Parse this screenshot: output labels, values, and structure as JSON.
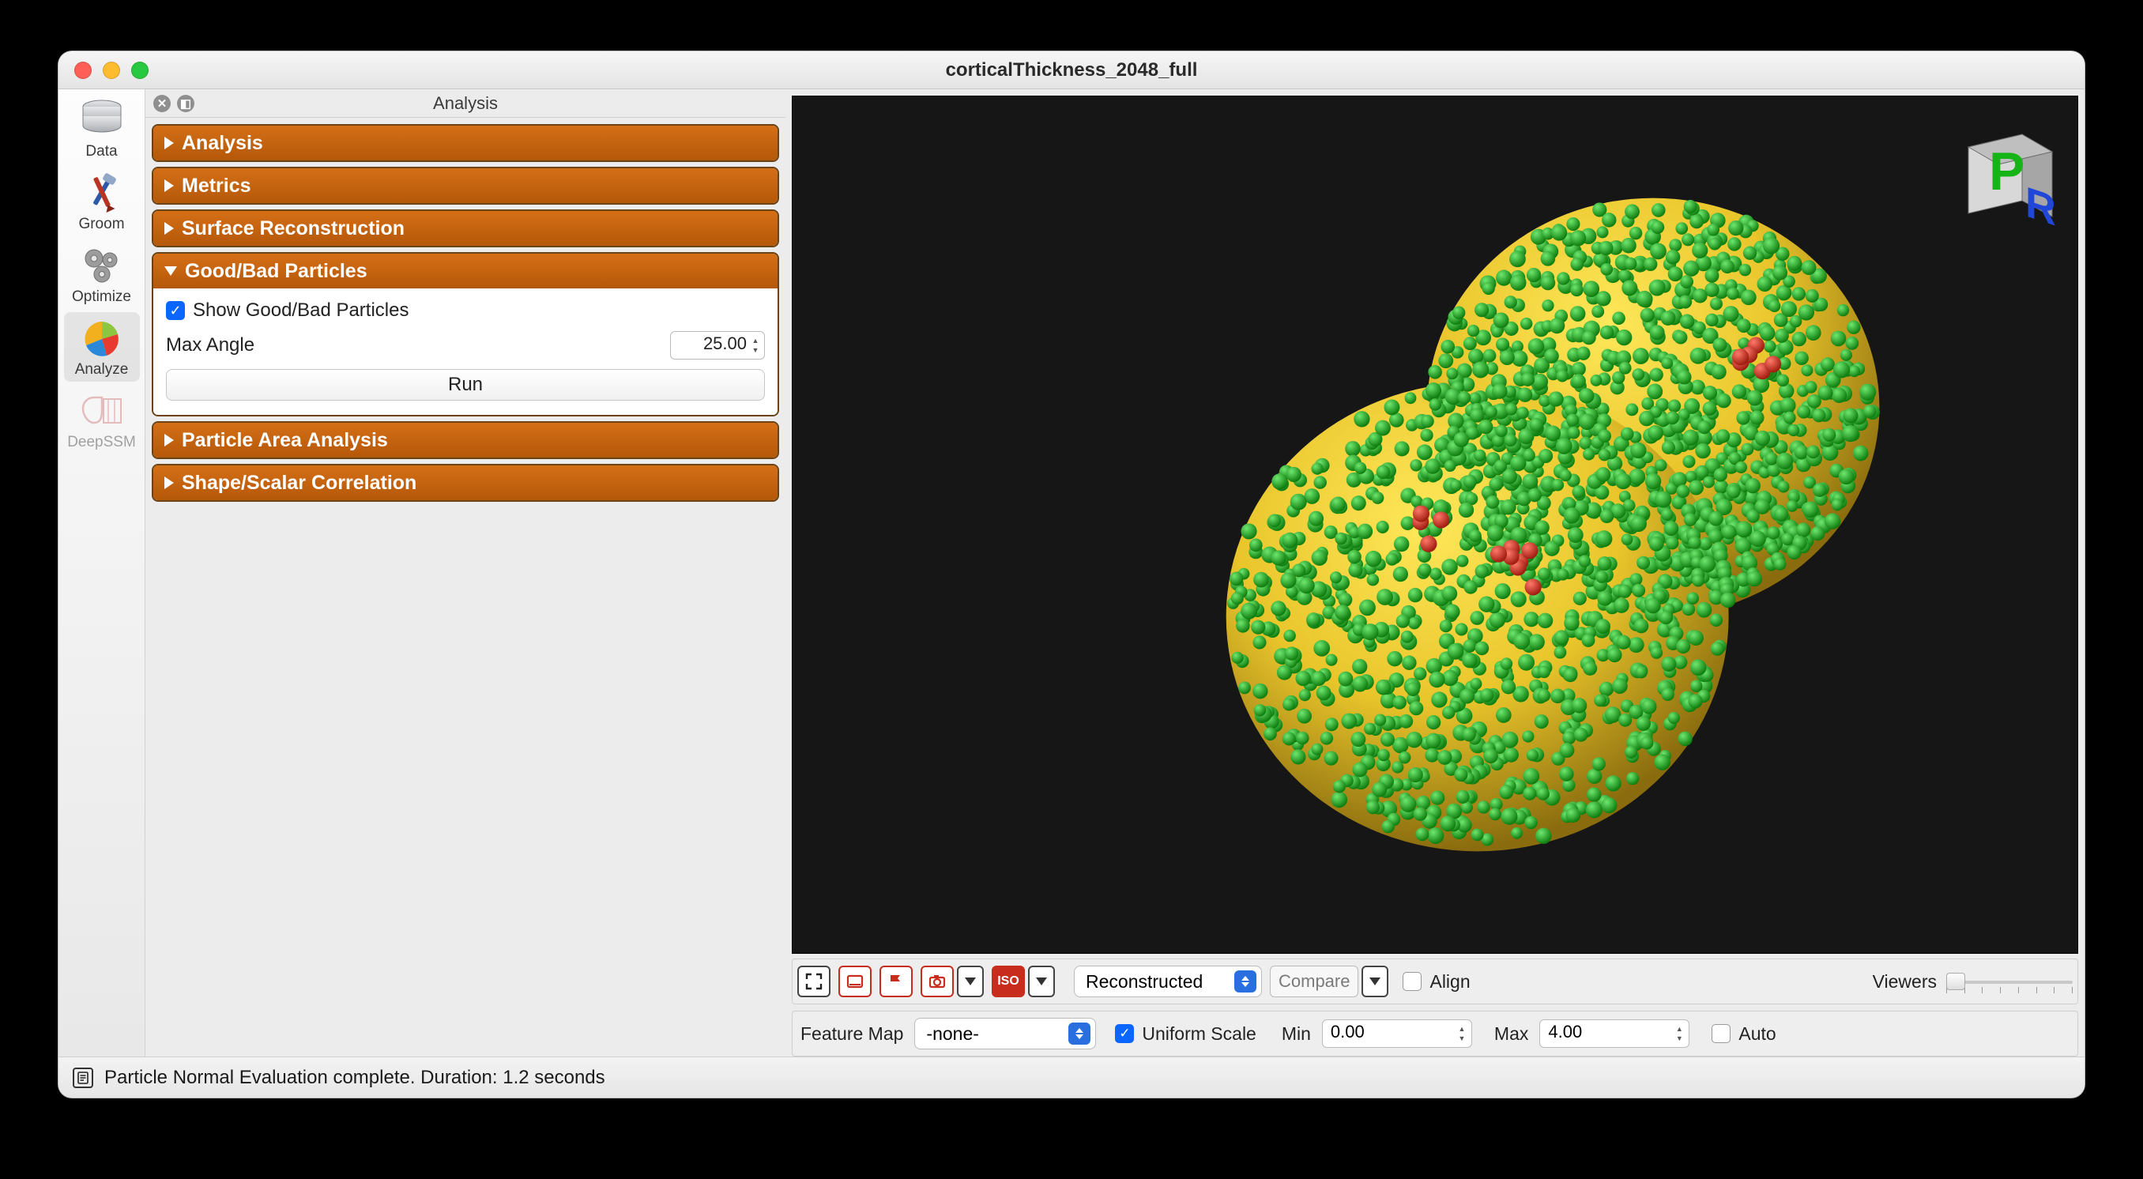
{
  "window": {
    "title": "corticalThickness_2048_full"
  },
  "iconbar": {
    "items": [
      {
        "id": "data",
        "label": "Data",
        "active": false
      },
      {
        "id": "groom",
        "label": "Groom",
        "active": false
      },
      {
        "id": "optimize",
        "label": "Optimize",
        "active": false
      },
      {
        "id": "analyze",
        "label": "Analyze",
        "active": true
      },
      {
        "id": "deepssm",
        "label": "DeepSSM",
        "active": false,
        "disabled": true
      }
    ]
  },
  "panel": {
    "header_label": "Analysis",
    "sections": {
      "analysis": "Analysis",
      "metrics": "Metrics",
      "surface": "Surface Reconstruction",
      "goodbad": "Good/Bad Particles",
      "area": "Particle Area Analysis",
      "shape": "Shape/Scalar Correlation"
    },
    "goodbad": {
      "show_label": "Show Good/Bad Particles",
      "show_checked": true,
      "max_angle_label": "Max Angle",
      "max_angle_value": "25.00",
      "run_label": "Run"
    }
  },
  "viewport": {
    "cube_faces": {
      "front": "P",
      "right": "R"
    }
  },
  "toolbar2": {
    "reconstructed_label": "Reconstructed",
    "compare_label": "Compare",
    "align_label": "Align",
    "align_checked": false,
    "viewers_label": "Viewers"
  },
  "toolbar3": {
    "feature_map_label": "Feature Map",
    "feature_map_value": "-none-",
    "uniform_scale_label": "Uniform Scale",
    "uniform_scale_checked": true,
    "min_label": "Min",
    "min_value": "0.00",
    "max_label": "Max",
    "max_value": "4.00",
    "auto_label": "Auto",
    "auto_checked": false
  },
  "toolbar_icons": {
    "fit": "fit-view-icon",
    "snap1": "snapshot-icon",
    "flag": "flag-icon",
    "camera": "camera-icon",
    "iso": "iso-icon"
  },
  "status": {
    "message": "Particle Normal Evaluation complete.  Duration: 1.2 seconds"
  }
}
